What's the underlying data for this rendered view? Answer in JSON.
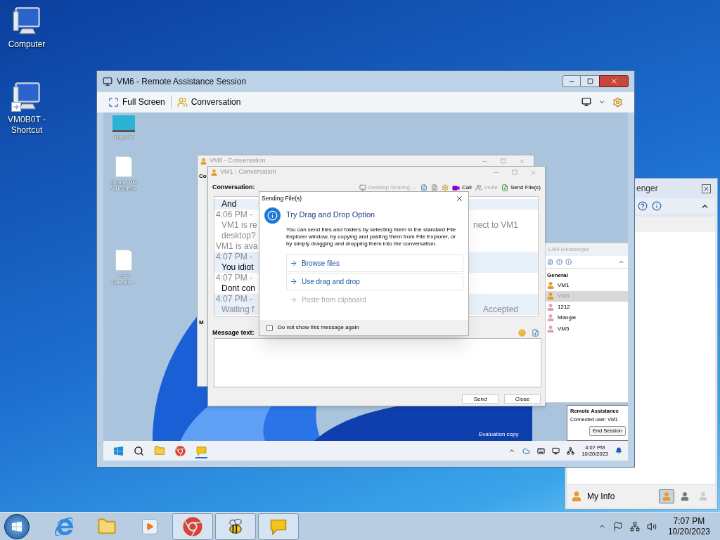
{
  "desktop": {
    "icons": [
      {
        "label": "Computer",
        "shortcut": false
      },
      {
        "label": "VM0B0T - Shortcut",
        "shortcut": true
      }
    ]
  },
  "messenger_window": {
    "title": "enger",
    "footer_label": "My Info",
    "status_buttons": [
      {
        "kind": "available",
        "selected": true
      },
      {
        "kind": "busy",
        "selected": false
      },
      {
        "kind": "offline",
        "selected": false
      }
    ]
  },
  "remote_window": {
    "title": "VM6 - Remote Assistance Session",
    "toolbar": [
      {
        "kind": "fullscreen",
        "label": "Full Screen"
      },
      {
        "kind": "conversation",
        "label": "Conversation"
      }
    ],
    "remote_desktop": {
      "icons": [
        {
          "kind": "pc",
          "label": "This PC"
        },
        {
          "kind": "file",
          "label": "Oracle VM VirtualBox"
        },
        {
          "kind": "file",
          "label": "Free Downlo..."
        }
      ],
      "evaluation_notice": "Evaluation copy",
      "taskbar": {
        "apps": [
          {
            "kind": "start",
            "running": false
          },
          {
            "kind": "search",
            "running": false
          },
          {
            "kind": "folder",
            "running": false
          },
          {
            "kind": "chrome",
            "running": false
          },
          {
            "kind": "messenger",
            "running": true
          }
        ],
        "clock": {
          "time": "4:07 PM",
          "date": "10/20/2023"
        }
      },
      "back_conversation": {
        "title": "VM6 - Conversation",
        "label": "Co",
        "label_2": "M"
      },
      "conversation": {
        "title": "VM1 - Conversation",
        "label": "Conversation:",
        "toolbar": [
          {
            "kind": "sharing",
            "label": "Desktop Sharing",
            "disabled": true
          },
          {
            "kind": "call",
            "label": "Call",
            "disabled": false
          },
          {
            "kind": "invite",
            "label": "Invite",
            "disabled": true
          },
          {
            "kind": "send",
            "label": "Send File(s)",
            "disabled": false
          }
        ],
        "messages": [
          {
            "kind": "message",
            "text": "And",
            "shaded": true
          },
          {
            "kind": "time",
            "text": "4:06 PM -",
            "shaded": false
          },
          {
            "kind": "status",
            "text": "VM1 is re",
            "right_text": "nect to VM1",
            "shaded": false
          },
          {
            "kind": "status",
            "text": "desktop?",
            "shaded": false
          },
          {
            "kind": "notice",
            "text": "VM1 is ava",
            "shaded": false
          },
          {
            "kind": "time",
            "text": "4:07 PM -",
            "shaded": true
          },
          {
            "kind": "message",
            "text": "You idiot",
            "shaded": true
          },
          {
            "kind": "time",
            "text": "4:07 PM -",
            "shaded": false
          },
          {
            "kind": "message",
            "text": "Dont con",
            "shaded": false
          },
          {
            "kind": "time",
            "text": "4:07 PM -",
            "shaded": true
          },
          {
            "kind": "status",
            "text": "Waiting f",
            "right_text": "Accepted",
            "shaded": true
          }
        ],
        "message_label": "Message text:",
        "actions": [
          {
            "label": "Send"
          },
          {
            "label": "Close"
          }
        ]
      },
      "dialog": {
        "title": "Sending File(s)",
        "heading": "Try Drag and Drop Option",
        "body": "You can send files and folders by selecting them in the standard File Explorer window, by copying and pasting them from File Explorer, or by simply dragging and dropping them into the conversation.",
        "options": [
          {
            "label": "Browse files",
            "disabled": false
          },
          {
            "label": "Use drag and drop",
            "disabled": false
          },
          {
            "label": "Paste from clipboard",
            "disabled": true
          }
        ],
        "checkbox": {
          "label": "Do not show this message again",
          "checked": false
        }
      },
      "lan_messenger": {
        "title": "LAN Messenger",
        "group": "General",
        "contacts": [
          {
            "name": "VM1",
            "online": true,
            "selected": false
          },
          {
            "name": "VM6",
            "online": true,
            "selected": true
          },
          {
            "name": "1212",
            "online": false,
            "selected": false
          },
          {
            "name": "Mangle",
            "online": false,
            "selected": false
          },
          {
            "name": "VM5",
            "online": false,
            "selected": false
          }
        ]
      },
      "remote_assistance": {
        "title": "Remote Assistance",
        "connected_user": "Connected user: VM1",
        "button": "End Session"
      }
    }
  },
  "taskbar": {
    "apps": [
      {
        "kind": "ie",
        "running": false
      },
      {
        "kind": "explorer",
        "running": false
      },
      {
        "kind": "media",
        "running": false
      },
      {
        "kind": "chrome",
        "running": true
      },
      {
        "kind": "bee",
        "running": true
      },
      {
        "kind": "messenger",
        "running": true
      }
    ],
    "clock": {
      "time": "7:07 PM",
      "date": "10/20/2023"
    }
  }
}
